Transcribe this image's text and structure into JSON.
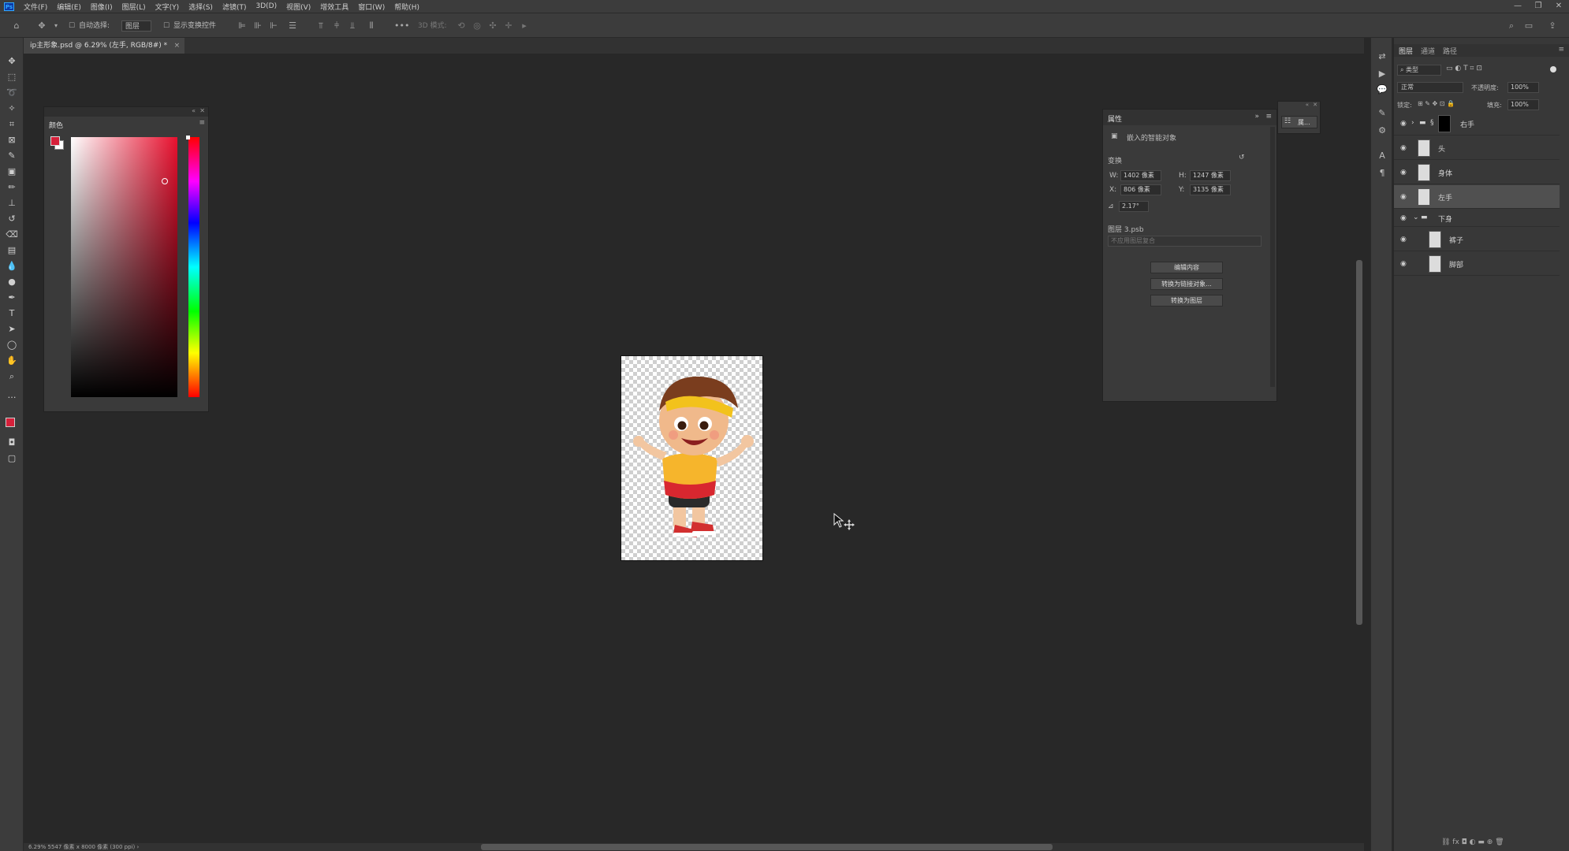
{
  "app": {
    "logo": "Ps"
  },
  "menu": [
    "文件(F)",
    "编辑(E)",
    "图像(I)",
    "图层(L)",
    "文字(Y)",
    "选择(S)",
    "滤镜(T)",
    "3D(D)",
    "视图(V)",
    "增效工具",
    "窗口(W)",
    "帮助(H)"
  ],
  "window_controls": {
    "minimize": "—",
    "restore": "❐",
    "close": "✕"
  },
  "options": {
    "auto_select_label": "自动选择:",
    "auto_select_value": "图层",
    "show_transform_label": "显示变换控件",
    "mode_3d_label": "3D 模式:"
  },
  "document_tab": {
    "title": "ip主形象.psd @ 6.29% (左手, RGB/8#) *",
    "close": "×"
  },
  "color_panel": {
    "title": "颜色",
    "foreground": "#d6203a",
    "background": "#ffffff"
  },
  "properties_panel": {
    "title": "属性",
    "object_type": "嵌入的智能对象",
    "section_transform": "变换",
    "w_label": "W:",
    "w_value": "1402 像素",
    "h_label": "H:",
    "h_value": "1247 像素",
    "x_label": "X:",
    "x_value": "806 像素",
    "y_label": "Y:",
    "y_value": "3135 像素",
    "angle_value": "2.17°",
    "file_name": "图层 3.psb",
    "comp_placeholder": "不应用图层复合",
    "btn_edit": "编辑内容",
    "btn_convert_linked": "转换为链接对象...",
    "btn_convert_layers": "转换为图层"
  },
  "mini_panel": {
    "label": "属..."
  },
  "layers_panel": {
    "tabs": [
      "图层",
      "通道",
      "路径"
    ],
    "filter_kind": "类型",
    "blend_mode": "正常",
    "opacity_label": "不透明度:",
    "opacity_value": "100%",
    "lock_label": "锁定:",
    "fill_label": "填充:",
    "fill_value": "100%",
    "layers": [
      {
        "name": "右手",
        "type": "group-masked",
        "selected": false
      },
      {
        "name": "头",
        "type": "smart",
        "selected": false
      },
      {
        "name": "身体",
        "type": "smart",
        "selected": false
      },
      {
        "name": "左手",
        "type": "smart",
        "selected": true
      },
      {
        "name": "下身",
        "type": "group",
        "selected": false
      },
      {
        "name": "裤子",
        "type": "smart-child",
        "selected": false
      },
      {
        "name": "脚部",
        "type": "smart-child",
        "selected": false
      }
    ]
  },
  "status_bar": {
    "text": "6.29%    5547 像素 x 8000 像素 (300 ppi)   ›"
  }
}
